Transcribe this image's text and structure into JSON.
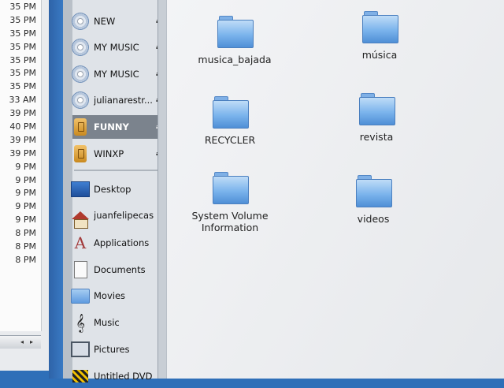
{
  "background_window": {
    "times": [
      "35 PM",
      "35 PM",
      "35 PM",
      "35 PM",
      "35 PM",
      "35 PM",
      "35 PM",
      "33 AM",
      "39 PM",
      "40 PM",
      "39 PM",
      "39 PM",
      "9 PM",
      "9 PM",
      "9 PM",
      "9 PM",
      "9 PM",
      "8 PM",
      "8 PM",
      "8 PM"
    ]
  },
  "sidebar": {
    "volumes": [
      {
        "label": "NEW",
        "icon": "cd-icon",
        "eject": "⏏"
      },
      {
        "label": "MY MUSIC",
        "icon": "cd-icon",
        "eject": "⏏"
      },
      {
        "label": "MY MUSIC",
        "icon": "cd-icon",
        "eject": "⏏"
      },
      {
        "label": "julianarestr...",
        "icon": "cd-icon",
        "eject": "⏏"
      },
      {
        "label": "FUNNY",
        "icon": "usb-drive-icon",
        "eject": "⏏",
        "selected": true
      },
      {
        "label": "WINXP",
        "icon": "usb-drive-icon",
        "eject": "⏏"
      }
    ],
    "places": [
      {
        "label": "Desktop",
        "icon": "desktop-icon"
      },
      {
        "label": "juanfelipecast...",
        "icon": "home-icon"
      },
      {
        "label": "Applications",
        "icon": "applications-icon"
      },
      {
        "label": "Documents",
        "icon": "document-icon"
      },
      {
        "label": "Movies",
        "icon": "folder-icon"
      },
      {
        "label": "Music",
        "icon": "music-note-icon"
      },
      {
        "label": "Pictures",
        "icon": "picture-icon"
      },
      {
        "label": "Untitled DVD",
        "icon": "dvd-icon"
      }
    ]
  },
  "main": {
    "folders": [
      {
        "name": "musica_bajada"
      },
      {
        "name": "música"
      },
      {
        "name": "RECYCLER"
      },
      {
        "name": "revista"
      },
      {
        "name": "System Volume Information"
      },
      {
        "name": "videos"
      }
    ]
  },
  "colors": {
    "selection": "#7b838d",
    "folder_blue": "#7ab3ec",
    "desktop_blue": "#2f6fb8"
  }
}
